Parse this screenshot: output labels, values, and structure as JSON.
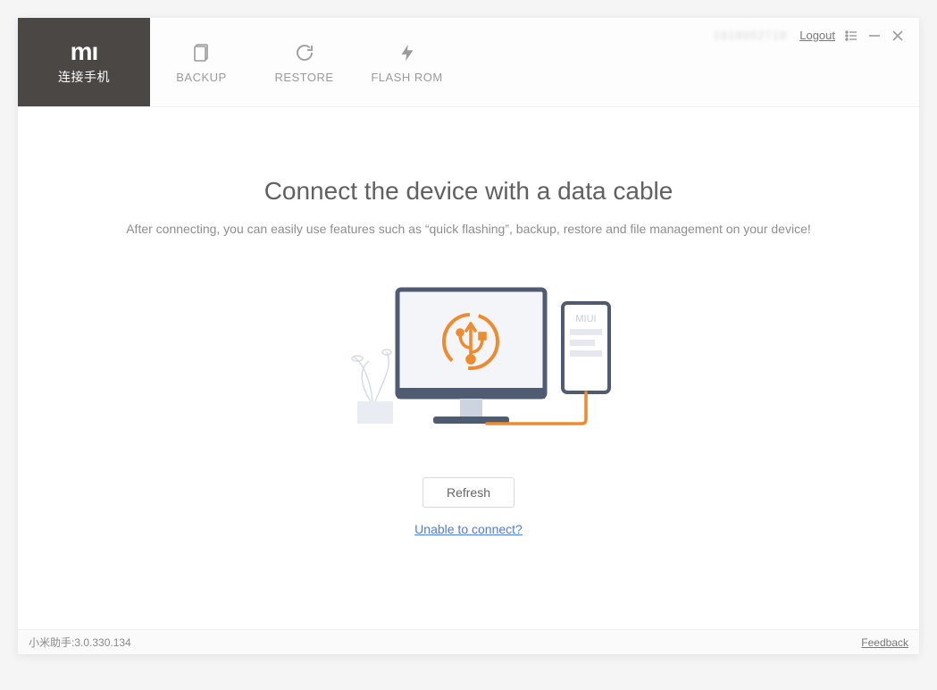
{
  "topbar": {
    "active_tab_sub": "连接手机",
    "tabs": [
      {
        "label": "BACKUP"
      },
      {
        "label": "RESTORE"
      },
      {
        "label": "FLASH ROM"
      }
    ],
    "account_id": "1618052718",
    "logout": "Logout"
  },
  "main": {
    "headline": "Connect the device with a data cable",
    "subline": "After connecting, you can easily use features such as “quick flashing”, backup, restore and file management on your device!",
    "phone_label": "MIUI",
    "refresh_button": "Refresh",
    "help_link": "Unable to connect?"
  },
  "footer": {
    "version": "小米助手:3.0.330.134",
    "feedback": "Feedback"
  }
}
